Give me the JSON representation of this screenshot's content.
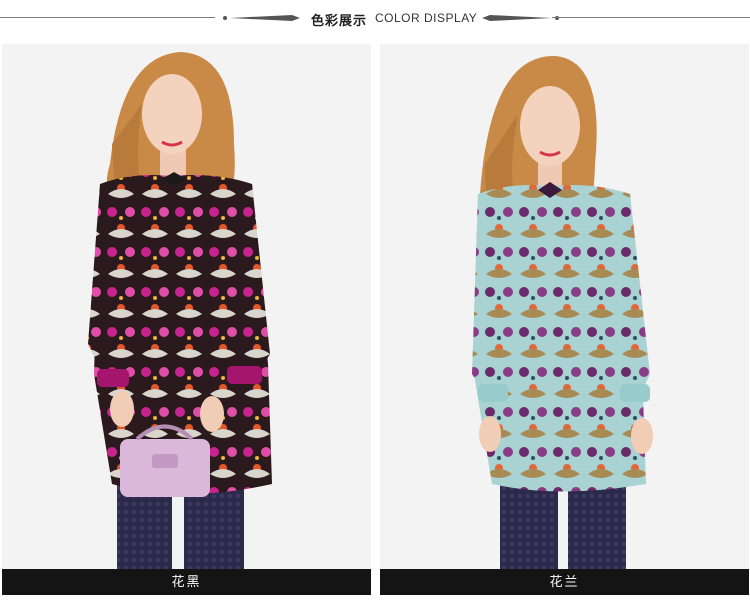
{
  "header": {
    "title_cn": "色彩展示",
    "title_en": "COLOR DISPLAY"
  },
  "panels": [
    {
      "caption": "花黑",
      "icon": "model-photo-black-floral-dress"
    },
    {
      "caption": "花兰",
      "icon": "model-photo-blue-floral-dress"
    }
  ],
  "colors": {
    "background": "#f5f5f5",
    "caption_bar": "#141414",
    "caption_text": "#ffffff",
    "dress_black_base": "#2a1a1e",
    "dress_black_accent": "#c8238f",
    "dress_blue_base": "#a9d3d3",
    "dress_blue_accent": "#6b2a6a",
    "hair": "#c98a47",
    "tights": "#2c2a4a"
  }
}
